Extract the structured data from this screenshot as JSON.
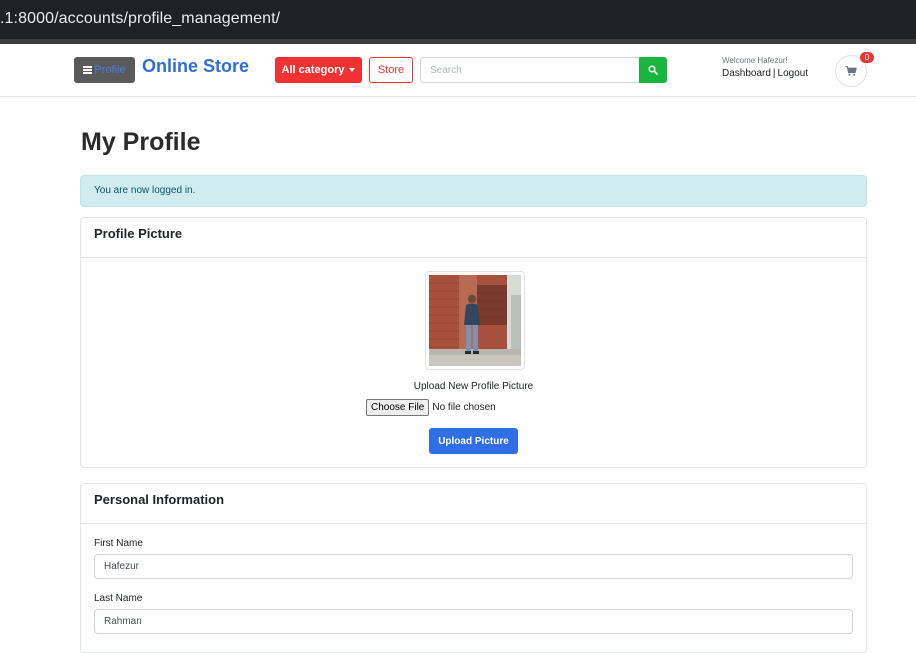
{
  "browser": {
    "url": ".1:8000/accounts/profile_management/"
  },
  "navbar": {
    "profile_button": "Profile",
    "brand": "Online Store",
    "category_button": "All category",
    "store_button": "Store",
    "search": {
      "placeholder": "Search",
      "value": ""
    },
    "welcome": "Welcome Hafezur!",
    "dashboard_link": "Dashboard",
    "separator": "|",
    "logout_link": "Logout",
    "cart_count": "0"
  },
  "page": {
    "title": "My Profile",
    "alert": "You are now logged in."
  },
  "profile_picture": {
    "heading": "Profile Picture",
    "upload_label": "Upload New Profile Picture",
    "choose_file": "Choose File",
    "file_status": "No file chosen",
    "upload_button": "Upload Picture"
  },
  "personal_info": {
    "heading": "Personal Information",
    "first_name": {
      "label": "First Name",
      "value": "Hafezur"
    },
    "last_name": {
      "label": "Last Name",
      "value": "Rahman"
    }
  },
  "colors": {
    "brand": "#2f6fd6",
    "category": "#f03232",
    "search_button": "#18b63c",
    "upload_button": "#2f6fe3",
    "alert_bg": "#d1ecf1",
    "badge": "#e53935"
  }
}
